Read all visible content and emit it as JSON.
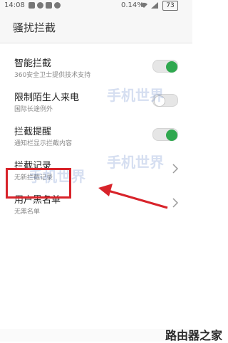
{
  "status_bar": {
    "time": "14:08",
    "battery_percent_text": "0.14%",
    "battery_level": "73"
  },
  "header": {
    "title": "骚扰拦截"
  },
  "rows": [
    {
      "label": "智能拦截",
      "sub": "360安全卫士提供技术支持",
      "control": "toggle",
      "on": true
    },
    {
      "label": "限制陌生人来电",
      "sub": "国际长途例外",
      "control": "toggle",
      "on": false
    },
    {
      "label": "拦截提醒",
      "sub": "通知栏显示拦截内容",
      "control": "toggle",
      "on": true
    },
    {
      "label": "拦截记录",
      "sub": "无新拦截记录",
      "control": "chevron"
    },
    {
      "label": "用户黑名单",
      "sub": "无黑名单",
      "control": "chevron"
    }
  ],
  "watermark": {
    "text": "手机世界",
    "bottom_logo": "路由器之家"
  },
  "colors": {
    "toggle_on": "#2fa84f",
    "highlight": "#d8232a"
  }
}
